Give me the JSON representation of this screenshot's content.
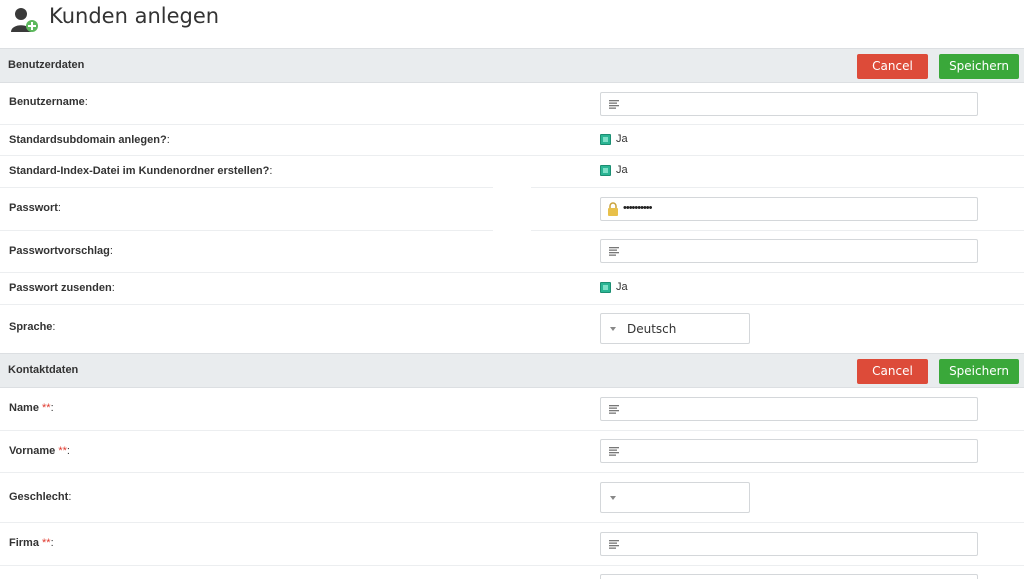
{
  "header": {
    "title": "Kunden anlegen",
    "icon": "user-add-icon"
  },
  "sections": {
    "benutzerdaten": {
      "title": "Benutzerdaten",
      "cancel_label": "Cancel",
      "save_label": "Speichern"
    },
    "kontaktdaten": {
      "title": "Kontaktdaten",
      "cancel_label": "Cancel",
      "save_label": "Speichern"
    }
  },
  "fields": {
    "benutzername": {
      "label": "Benutzername",
      "suffix": ":",
      "value": ""
    },
    "subdomain": {
      "label": "Standardsubdomain anlegen?",
      "suffix": ":",
      "checkbox_label": "Ja",
      "checked": true
    },
    "index_datei": {
      "label": "Standard-Index-Datei im Kundenordner erstellen?",
      "suffix": ":",
      "checkbox_label": "Ja",
      "checked": true
    },
    "passwort": {
      "label": "Passwort",
      "suffix": ":",
      "value": "••••••••••"
    },
    "passwortvorschlag": {
      "label": "Passwortvorschlag",
      "suffix": ":",
      "value": ""
    },
    "passwort_zusenden": {
      "label": "Passwort zusenden",
      "suffix": ":",
      "checkbox_label": "Ja",
      "checked": true
    },
    "sprache": {
      "label": "Sprache",
      "suffix": ":",
      "selected": "Deutsch"
    },
    "name": {
      "label": "Name",
      "required_mark": "**",
      "suffix": ":",
      "value": ""
    },
    "vorname": {
      "label": "Vorname",
      "required_mark": "**",
      "suffix": ":",
      "value": ""
    },
    "geschlecht": {
      "label": "Geschlecht",
      "suffix": ":",
      "selected": ""
    },
    "firma": {
      "label": "Firma",
      "required_mark": "**",
      "suffix": ":",
      "value": ""
    }
  },
  "colors": {
    "cancel": "#dd4b39",
    "save": "#3aa83a",
    "checkbox": "#2bb594",
    "required": "#e03a2f",
    "section_bg": "#e9ecee"
  }
}
